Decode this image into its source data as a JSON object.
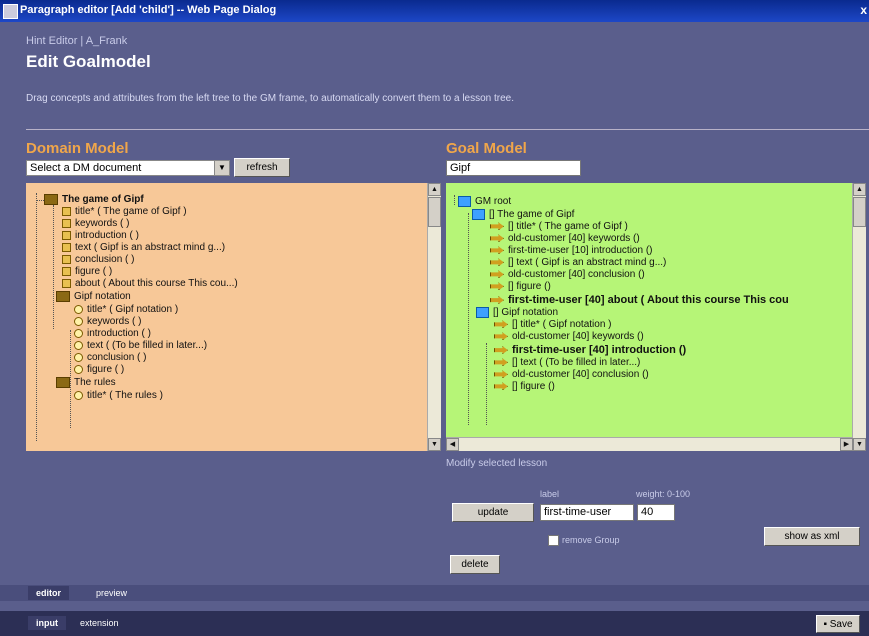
{
  "window": {
    "title": "Paragraph editor [Add 'child'] -- Web Page Dialog",
    "close": "x"
  },
  "header": {
    "breadcrumb": "Hint Editor | A_Frank",
    "title": "Edit Goalmodel",
    "description": "Drag concepts and attributes from the left tree to the GM frame, to automatically convert them to a lesson tree."
  },
  "domain": {
    "heading": "Domain Model",
    "select_value": "Select a DM document",
    "refresh_label": "refresh",
    "nodes": [
      {
        "text": "The game of Gipf",
        "icon": "book",
        "bold": true
      },
      {
        "text": "title* ( The game of Gipf )",
        "icon": "sq"
      },
      {
        "text": "keywords ( )",
        "icon": "sq"
      },
      {
        "text": "introduction ( )",
        "icon": "sq"
      },
      {
        "text": "text ( Gipf is an abstract mind g...)",
        "icon": "sq"
      },
      {
        "text": "conclusion ( )",
        "icon": "sq"
      },
      {
        "text": "figure ( )",
        "icon": "sq"
      },
      {
        "text": "about ( About this course This cou...)",
        "icon": "sq"
      },
      {
        "text": "Gipf notation",
        "icon": "book"
      },
      {
        "text": "title* ( Gipf notation )",
        "icon": "circ"
      },
      {
        "text": "keywords ( )",
        "icon": "circ"
      },
      {
        "text": "introduction ( )",
        "icon": "circ"
      },
      {
        "text": "text ( (To be filled in later...)",
        "icon": "circ"
      },
      {
        "text": "conclusion ( )",
        "icon": "circ"
      },
      {
        "text": "figure ( )",
        "icon": "circ"
      },
      {
        "text": "The rules",
        "icon": "book"
      },
      {
        "text": "title* ( The rules )",
        "icon": "circ"
      }
    ]
  },
  "goal": {
    "heading": "Goal Model",
    "name_value": "Gipf",
    "nodes": [
      {
        "text": "GM root",
        "icon": "folder"
      },
      {
        "text": "[] The game of Gipf",
        "icon": "folder"
      },
      {
        "text": "[] title* ( The game of Gipf )",
        "icon": "arrow"
      },
      {
        "text": "old-customer [40] keywords ()",
        "icon": "arrow"
      },
      {
        "text": "first-time-user [10] introduction ()",
        "icon": "arrow"
      },
      {
        "text": "[] text ( Gipf is an abstract mind g...)",
        "icon": "arrow"
      },
      {
        "text": "old-customer [40] conclusion ()",
        "icon": "arrow"
      },
      {
        "text": "[] figure ()",
        "icon": "arrow"
      },
      {
        "text": "first-time-user [40] about ( About this course This cou",
        "icon": "arrow",
        "bold": true
      },
      {
        "text": "[] Gipf notation",
        "icon": "folder"
      },
      {
        "text": "[] title* ( Gipf notation )",
        "icon": "arrow"
      },
      {
        "text": "old-customer [40] keywords ()",
        "icon": "arrow"
      },
      {
        "text": "first-time-user [40] introduction ()",
        "icon": "arrow",
        "bold": true
      },
      {
        "text": "[] text ( (To be filled in later...)",
        "icon": "arrow"
      },
      {
        "text": "old-customer [40] conclusion ()",
        "icon": "arrow"
      },
      {
        "text": "[] figure ()",
        "icon": "arrow"
      }
    ]
  },
  "modify": {
    "heading": "Modify selected lesson",
    "label_caption": "label",
    "weight_caption": "weight: 0-100",
    "update_label": "update",
    "label_value": "first-time-user",
    "weight_value": "40",
    "remove_group_label": "remove Group",
    "show_label": "show as xml",
    "delete_label": "delete"
  },
  "tabs_upper": [
    "editor",
    "preview"
  ],
  "tabs_lower": [
    "input",
    "extension"
  ],
  "save_label": "Save"
}
